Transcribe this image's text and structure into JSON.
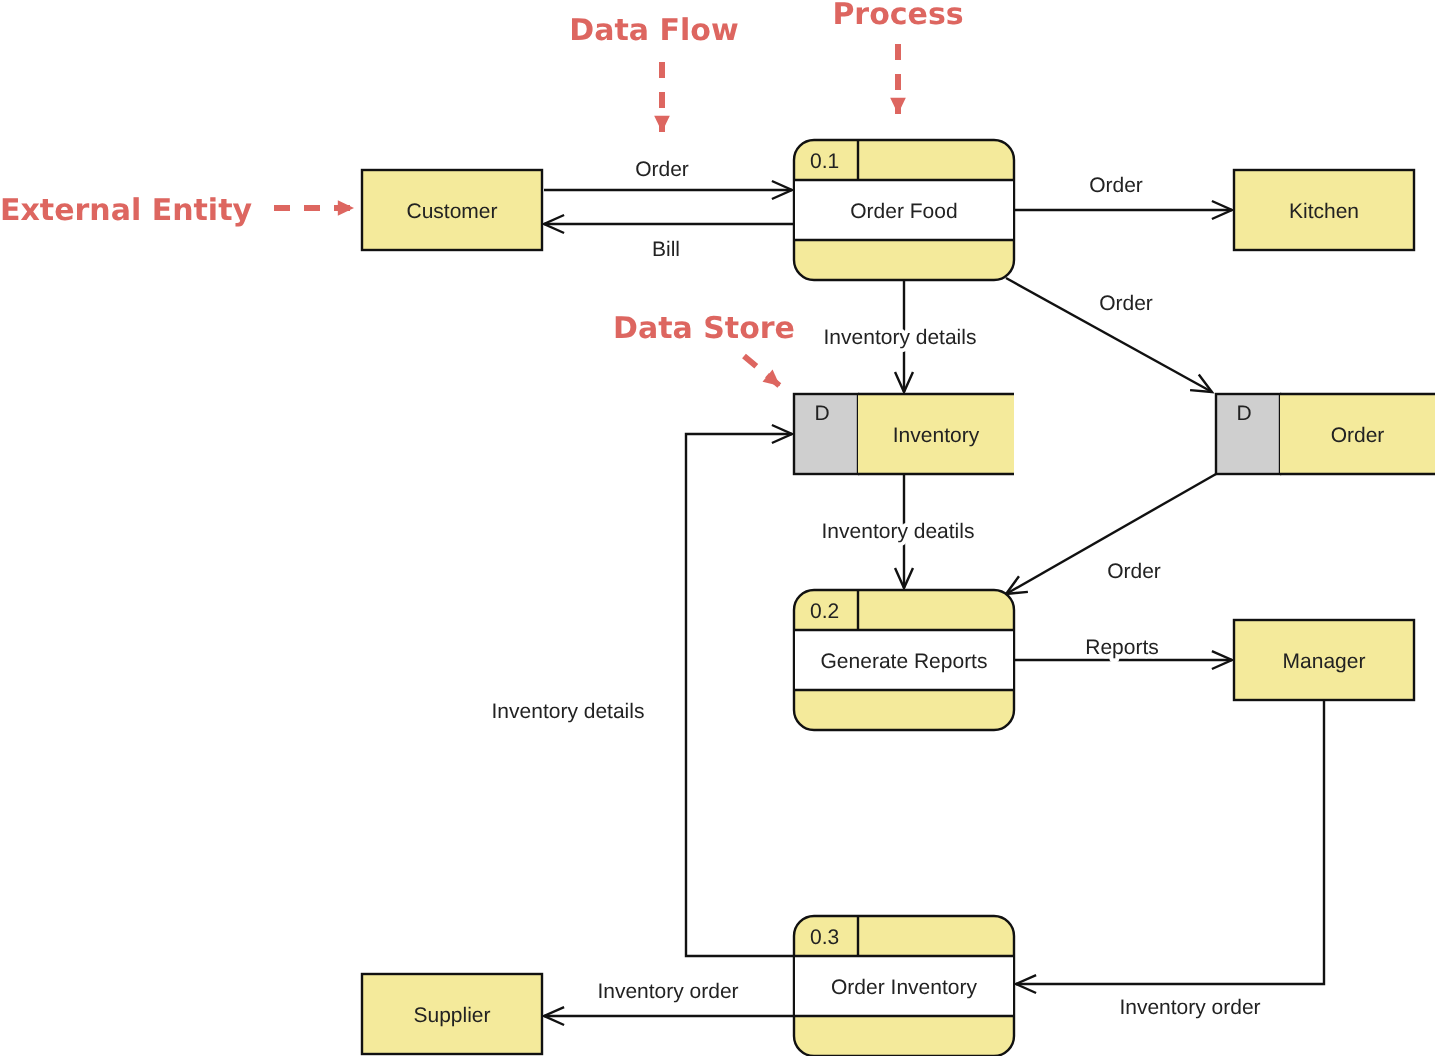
{
  "diagram": {
    "callouts": [
      {
        "text": "Data Flow"
      },
      {
        "text": "Process"
      },
      {
        "text": "External Entity"
      },
      {
        "text": "Data Store"
      }
    ],
    "external_entities": [
      {
        "name": "Customer"
      },
      {
        "name": "Kitchen"
      },
      {
        "name": "Manager"
      },
      {
        "name": "Supplier"
      }
    ],
    "processes": [
      {
        "number": "0.1",
        "name": "Order Food"
      },
      {
        "number": "0.2",
        "name": "Generate Reports"
      },
      {
        "number": "0.3",
        "name": "Order Inventory"
      }
    ],
    "data_stores": [
      {
        "id": "D",
        "name": "Inventory"
      },
      {
        "id": "D",
        "name": "Order"
      }
    ],
    "data_flows": [
      {
        "label": "Order"
      },
      {
        "label": "Bill"
      },
      {
        "label": "Order"
      },
      {
        "label": "Order"
      },
      {
        "label": "Inventory details"
      },
      {
        "label": "Inventory deatils"
      },
      {
        "label": "Order"
      },
      {
        "label": "Reports"
      },
      {
        "label": "Inventory details"
      },
      {
        "label": "Inventory order"
      },
      {
        "label": "Inventory order"
      }
    ]
  }
}
